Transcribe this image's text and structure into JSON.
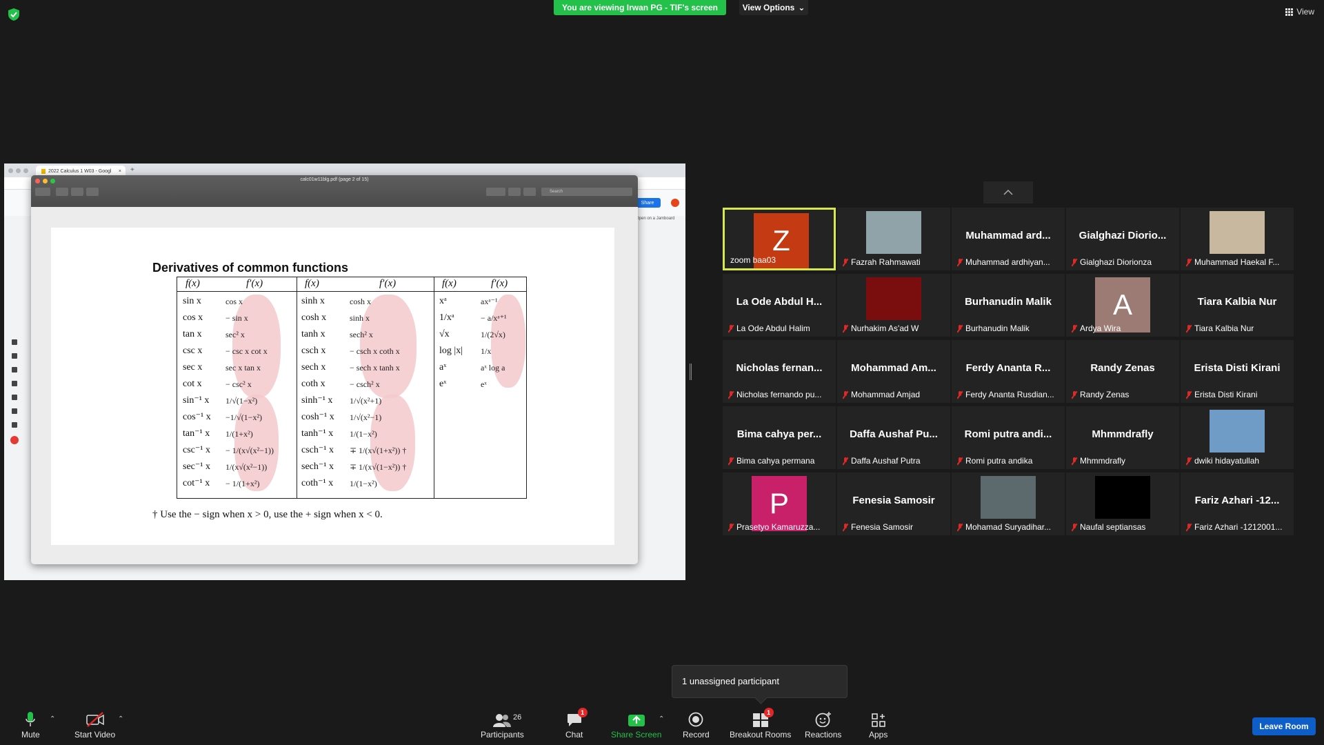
{
  "banner": {
    "viewing_text": "You are viewing Irwan PG - TIF's screen",
    "view_options": "View Options",
    "view_label": "View"
  },
  "shared": {
    "chrome_tab_title": "2022 Calculus 1 W03 - Googl",
    "preview_title": "calc01w11blg.pdf (page 2 of 15)",
    "search_placeholder": "Search",
    "share_label": "Share",
    "jamboard_link": "Open on a Jamboard",
    "pdf_title": "Derivatives of common functions",
    "headers": [
      "f(x)",
      "f′(x)",
      "f(x)",
      "f′(x)",
      "f(x)",
      "f′(x)"
    ],
    "col1": [
      "sin x",
      "cos x",
      "tan x",
      "csc x",
      "sec x",
      "cot x",
      "sin⁻¹ x",
      "cos⁻¹ x",
      "tan⁻¹ x",
      "csc⁻¹ x",
      "sec⁻¹ x",
      "cot⁻¹ x"
    ],
    "col2": [
      "cos x",
      "− sin x",
      "sec² x",
      "− csc x cot x",
      "sec x tan x",
      "− csc² x",
      "1/√(1−x²)",
      "−1/√(1−x²)",
      "1/(1+x²)",
      "− 1/(x√(x²−1))",
      "1/(x√(x²−1))",
      "− 1/(1+x²)"
    ],
    "col3": [
      "sinh x",
      "cosh x",
      "tanh x",
      "csch x",
      "sech x",
      "coth x",
      "sinh⁻¹ x",
      "cosh⁻¹ x",
      "tanh⁻¹ x",
      "csch⁻¹ x",
      "sech⁻¹ x",
      "coth⁻¹ x"
    ],
    "col4": [
      "cosh x",
      "sinh x",
      "sech² x",
      "− csch x coth x",
      "− sech x tanh x",
      "− csch² x",
      "1/√(x²+1)",
      "1/√(x²−1)",
      "1/(1−x²)",
      "∓ 1/(x√(1+x²)) †",
      "∓ 1/(x√(1−x²)) †",
      "1/(1−x²)"
    ],
    "col5": [
      "xᵃ",
      "1/xᵃ",
      "√x",
      "log |x|",
      "aˣ",
      "eˣ"
    ],
    "col6": [
      "axᵃ⁻¹",
      "− a/xᵃ⁺¹",
      "1/(2√x)",
      "1/x",
      "aˣ log a",
      "eˣ"
    ],
    "footnote": "† Use the − sign when x > 0, use the + sign when x < 0."
  },
  "participants": [
    {
      "name": "",
      "label": "zoom baa03",
      "avatar": "Z",
      "avatar_color": "#c43a12",
      "muted": false,
      "active": true
    },
    {
      "name": "",
      "label": "Fazrah Rahmawati",
      "photo": "#8fa3a8",
      "muted": true
    },
    {
      "name": "Muhammad ard...",
      "label": "Muhammad ardhiyan...",
      "muted": true
    },
    {
      "name": "Gialghazi Diorio...",
      "label": "Gialghazi Diorionza",
      "muted": true
    },
    {
      "name": "",
      "label": "Muhammad Haekal F...",
      "photo": "#c9b8a0",
      "muted": true
    },
    {
      "name": "La Ode Abdul H...",
      "label": "La Ode Abdul Halim",
      "muted": true
    },
    {
      "name": "",
      "label": "Nurhakim As'ad W",
      "photo": "#7a0e0e",
      "muted": true
    },
    {
      "name": "Burhanudin Malik",
      "label": "Burhanudin Malik",
      "muted": true
    },
    {
      "name": "",
      "label": "Ardya Wira",
      "avatar": "A",
      "avatar_color": "#9b7b74",
      "muted": true
    },
    {
      "name": "Tiara Kalbia Nur",
      "label": "Tiara Kalbia Nur",
      "muted": true
    },
    {
      "name": "Nicholas fernan...",
      "label": "Nicholas fernando pu...",
      "muted": true
    },
    {
      "name": "Mohammad Am...",
      "label": "Mohammad Amjad",
      "muted": true
    },
    {
      "name": "Ferdy Ananta R...",
      "label": "Ferdy Ananta Rusdian...",
      "muted": true
    },
    {
      "name": "Randy Zenas",
      "label": "Randy Zenas",
      "muted": true
    },
    {
      "name": "Erista Disti Kirani",
      "label": "Erista Disti Kirani",
      "muted": true
    },
    {
      "name": "Bima cahya per...",
      "label": "Bima cahya permana",
      "muted": true
    },
    {
      "name": "Daffa Aushaf Pu...",
      "label": "Daffa Aushaf Putra",
      "muted": true
    },
    {
      "name": "Romi putra andi...",
      "label": "Romi putra andika",
      "muted": true
    },
    {
      "name": "Mhmmdrafly",
      "label": "Mhmmdrafly",
      "muted": true
    },
    {
      "name": "",
      "label": "dwiki hidayatullah",
      "photo": "#6f9bc7",
      "muted": true
    },
    {
      "name": "",
      "label": "Prasetyo Kamaruzza...",
      "avatar": "P",
      "avatar_color": "#c9206a",
      "muted": true
    },
    {
      "name": "Fenesia Samosir",
      "label": "Fenesia Samosir",
      "muted": true
    },
    {
      "name": "",
      "label": "Mohamad Suryadihar...",
      "photo": "#5c6a6e",
      "muted": true
    },
    {
      "name": "",
      "label": "Naufal septiansas",
      "photo": "#000000",
      "muted": true
    },
    {
      "name": "Fariz Azhari -12...",
      "label": "Fariz Azhari -1212001...",
      "muted": true
    }
  ],
  "tooltip": {
    "unassigned": "1 unassigned participant"
  },
  "toolbar": {
    "mute": "Mute",
    "start_video": "Start Video",
    "participants": "Participants",
    "participants_count": "26",
    "chat": "Chat",
    "chat_badge": "1",
    "share_screen": "Share Screen",
    "record": "Record",
    "breakout_rooms": "Breakout Rooms",
    "breakout_badge": "1",
    "reactions": "Reactions",
    "apps": "Apps",
    "leave_room": "Leave Room"
  },
  "colors": {
    "banner_green": "#23c04a",
    "active_speaker": "#d7e84d",
    "leave_blue": "#0e5ec9",
    "muted_red": "#e02828"
  }
}
